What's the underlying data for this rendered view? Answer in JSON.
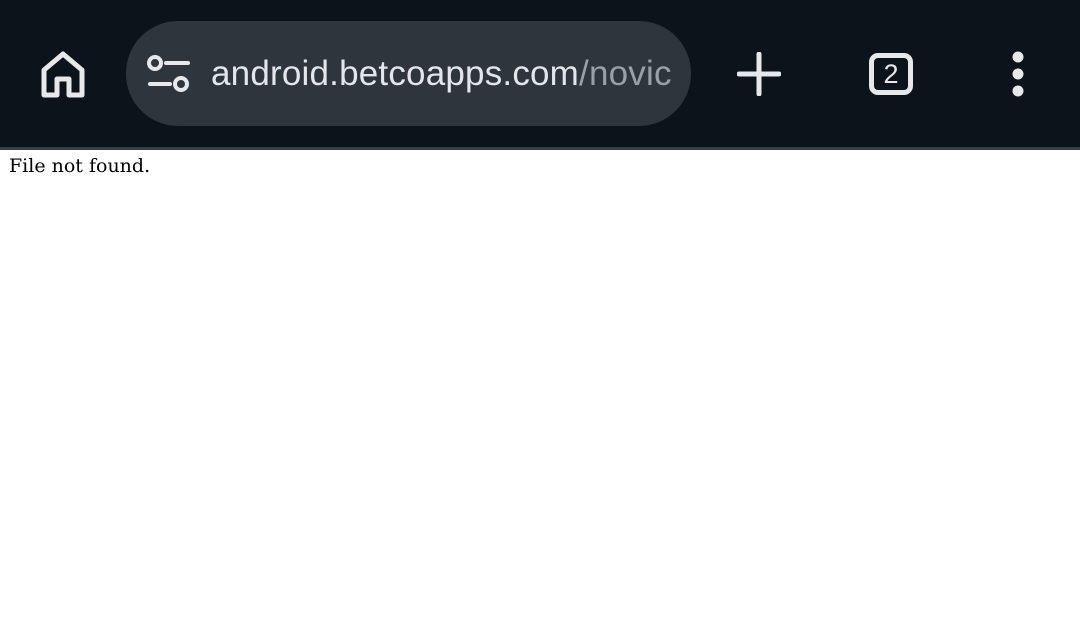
{
  "browser": {
    "toolbar": {
      "home_icon": "home-icon",
      "site_info_icon": "tune-icon",
      "url_host": "android.betcoapps.com",
      "url_path": "/novic",
      "new_tab_icon": "plus-icon",
      "tab_count": "2",
      "menu_icon": "more-vert-icon"
    },
    "colors": {
      "toolbar_bg": "#0d131b",
      "omnibox_bg": "#2f353c",
      "url_host_color": "#e3e6ea",
      "url_path_color": "#9aa0a6"
    }
  },
  "page": {
    "body_text": "File not found."
  }
}
